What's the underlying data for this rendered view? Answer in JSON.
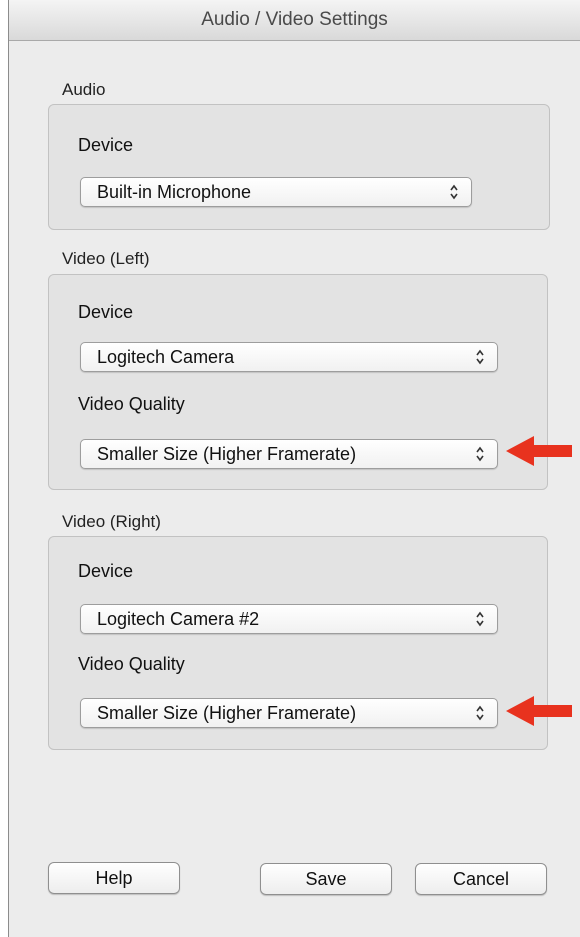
{
  "window": {
    "title": "Audio / Video Settings"
  },
  "audio": {
    "section_label": "Audio",
    "device_label": "Device",
    "device_value": "Built-in Microphone"
  },
  "video_left": {
    "section_label": "Video (Left)",
    "device_label": "Device",
    "device_value": "Logitech Camera",
    "quality_label": "Video Quality",
    "quality_value": "Smaller Size (Higher Framerate)"
  },
  "video_right": {
    "section_label": "Video (Right)",
    "device_label": "Device",
    "device_value": "Logitech Camera #2",
    "quality_label": "Video Quality",
    "quality_value": "Smaller Size (Higher Framerate)"
  },
  "buttons": {
    "help": "Help",
    "save": "Save",
    "cancel": "Cancel"
  },
  "colors": {
    "callout_arrow": "#e8321e",
    "window_bg": "#ececec",
    "group_bg": "#e3e3e3"
  },
  "icons": {
    "popup_arrows": "updown-chevron-icon",
    "callout": "red-arrow-icon"
  }
}
